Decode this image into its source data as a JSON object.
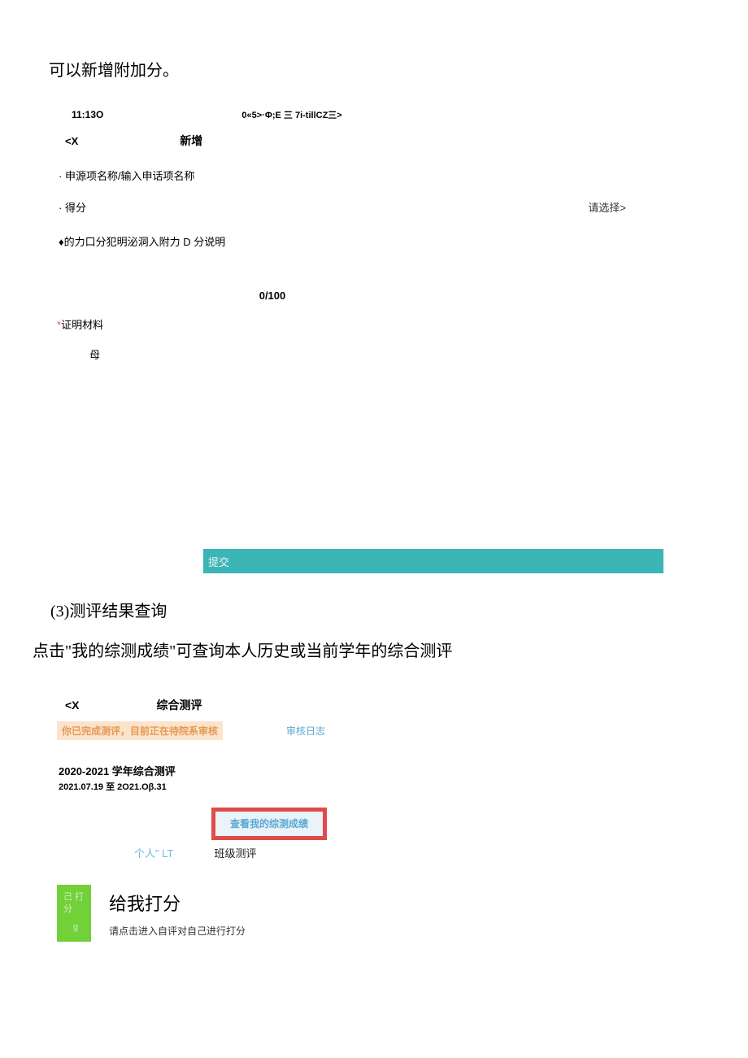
{
  "doc": {
    "intro": "可以新增附加分。",
    "section3_title": "(3)测评结果查询",
    "section3_desc": "点击\"我的综测成绩\"可查询本人历史或当前学年的综合测评"
  },
  "phone1": {
    "status_time": "11:13",
    "status_icon": "O",
    "status_right": "0«5>·Φ;E 三 7i-tillCZ三>",
    "nav_back": "<X",
    "nav_title": "新增",
    "row_name": "· 申源项名称/输入申话项名称",
    "row_score_label": "· 得分",
    "row_score_value": "请选择>",
    "row_desc": "♦的力口分犯明泌洞入附力 D 分说明",
    "counter": "0/100",
    "proof_label": "证明材料",
    "mu": "母",
    "submit": "提交"
  },
  "phone2": {
    "nav_back": "<X",
    "nav_title": "综合测评",
    "status_badge": "你已完成测评，目前正在待院系审核",
    "audit_log": "审核日志",
    "task_title": "2020-2021 学年综合测评",
    "task_date": "2021.07.19 至 2O21.Oβ.31",
    "view_btn": "查看我的综测成绩",
    "tab_personal": "个人\" LT",
    "tab_class": "班级测评",
    "green_line1": "己 打",
    "green_line1b": "分",
    "green_line2": "g",
    "rate_title": "给我打分",
    "rate_desc": "请点击进入自评对自己进行打分"
  }
}
